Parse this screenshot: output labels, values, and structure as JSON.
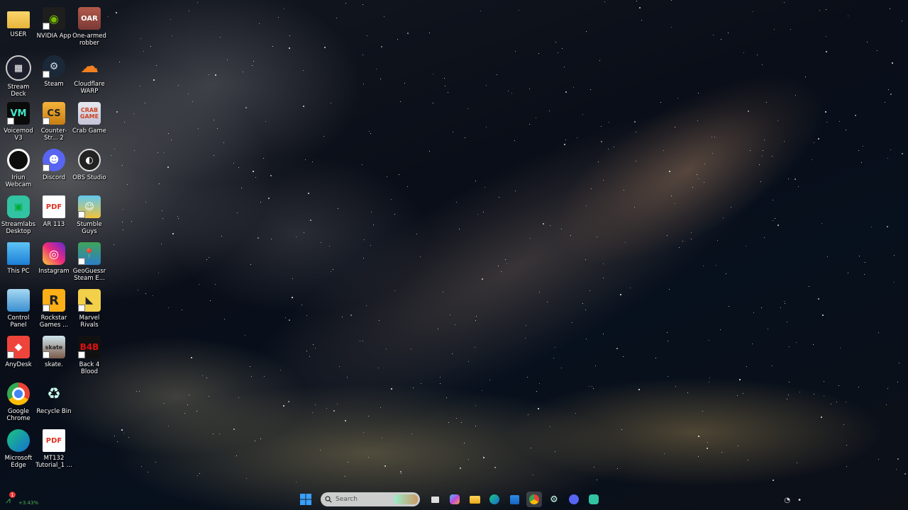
{
  "desktop": {
    "icons": [
      {
        "label": "USER",
        "icon": "folder-icon"
      },
      {
        "label": "NVIDIA App",
        "icon": "nvidia-icon"
      },
      {
        "label": "One-armed robber",
        "icon": "slot-machine-icon"
      },
      {
        "label": "Stream Deck",
        "icon": "stream-deck-icon"
      },
      {
        "label": "Steam",
        "icon": "steam-icon"
      },
      {
        "label": "Cloudflare WARP",
        "icon": "cloudflare-icon"
      },
      {
        "label": "Voicemod V3",
        "icon": "voicemod-icon"
      },
      {
        "label": "Counter-Str... 2",
        "icon": "counter-strike-icon"
      },
      {
        "label": "Crab Game",
        "icon": "crab-game-icon"
      },
      {
        "label": "Iriun Webcam",
        "icon": "webcam-icon"
      },
      {
        "label": "Discord",
        "icon": "discord-icon"
      },
      {
        "label": "OBS Studio",
        "icon": "obs-icon"
      },
      {
        "label": "Streamlabs Desktop",
        "icon": "streamlabs-icon"
      },
      {
        "label": "AR 113",
        "icon": "pdf-icon"
      },
      {
        "label": "Stumble Guys",
        "icon": "stumble-guys-icon"
      },
      {
        "label": "This PC",
        "icon": "computer-icon"
      },
      {
        "label": "Instagram",
        "icon": "instagram-icon"
      },
      {
        "label": "GeoGuessr Steam E...",
        "icon": "geoguessr-icon"
      },
      {
        "label": "Control Panel",
        "icon": "control-panel-icon"
      },
      {
        "label": "Rockstar Games ...",
        "icon": "rockstar-icon"
      },
      {
        "label": "Marvel Rivals",
        "icon": "marvel-rivals-icon"
      },
      {
        "label": "AnyDesk",
        "icon": "anydesk-icon"
      },
      {
        "label": "skate.",
        "icon": "skate-icon"
      },
      {
        "label": "Back 4 Blood",
        "icon": "back4blood-icon"
      },
      {
        "label": "Google Chrome",
        "icon": "chrome-icon"
      },
      {
        "label": "Recycle Bin",
        "icon": "recycle-bin-icon"
      },
      {
        "label": "Microsoft Edge",
        "icon": "edge-icon"
      },
      {
        "label": "MT132 Tutorial_1 ...",
        "icon": "pdf-icon"
      }
    ]
  },
  "taskbar": {
    "search_placeholder": "Search",
    "stock_change": "+3.43%",
    "stock_badge": "1",
    "pinned": [
      "start-icon",
      "search-icon",
      "task-view-icon",
      "copilot-icon",
      "file-explorer-icon",
      "edge-icon",
      "store-icon",
      "chrome-icon",
      "steam-icon",
      "discord-icon",
      "streamlabs-icon"
    ]
  },
  "colors": {
    "accent": "#0078d4",
    "stock_green": "#4caf50"
  }
}
